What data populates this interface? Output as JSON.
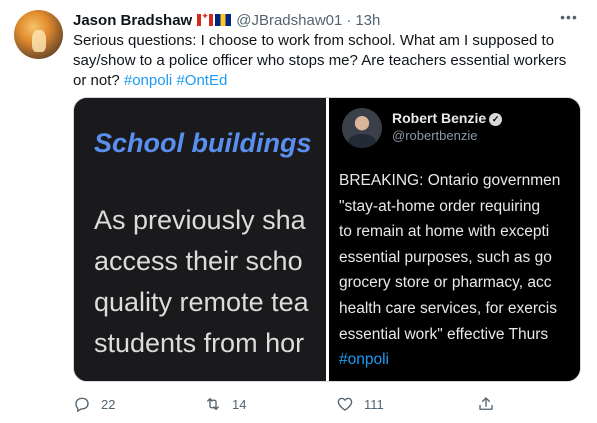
{
  "author": {
    "name": "Jason Bradshaw",
    "handle": "@JBradshaw01",
    "separator": "·",
    "time": "13h",
    "flags": [
      "canada-flag",
      "barbados-flag"
    ]
  },
  "tweet": {
    "text": "Serious questions: I choose to work from school. What am I supposed to say/show to a police officer who stops me? Are teachers essential workers or not?",
    "hashtags": [
      "#onpoli",
      "#OntEd"
    ]
  },
  "media": {
    "left": {
      "heading": "School buildings",
      "lines": [
        "As previously sha",
        "access their scho",
        "quality remote tea",
        "students from hor"
      ]
    },
    "right": {
      "name": "Robert Benzie",
      "handle": "@robertbenzie",
      "lines": [
        "BREAKING: Ontario governmen",
        "\"stay-at-home order requiring",
        "to remain at home with excepti",
        "essential purposes, such as go",
        "grocery store or pharmacy, acc",
        "health care services, for exercis",
        "essential work\" effective Thurs"
      ],
      "hashtag": "#onpoli"
    }
  },
  "actions": {
    "reply_count": "22",
    "retweet_count": "14",
    "like_count": "111"
  },
  "colors": {
    "accent": "#1d9bf0",
    "muted": "#536471",
    "text": "#0f1419"
  },
  "icons": {
    "more": "more-icon",
    "reply": "reply-icon",
    "retweet": "retweet-icon",
    "like": "heart-icon",
    "share": "share-icon",
    "verified": "verified-icon"
  }
}
